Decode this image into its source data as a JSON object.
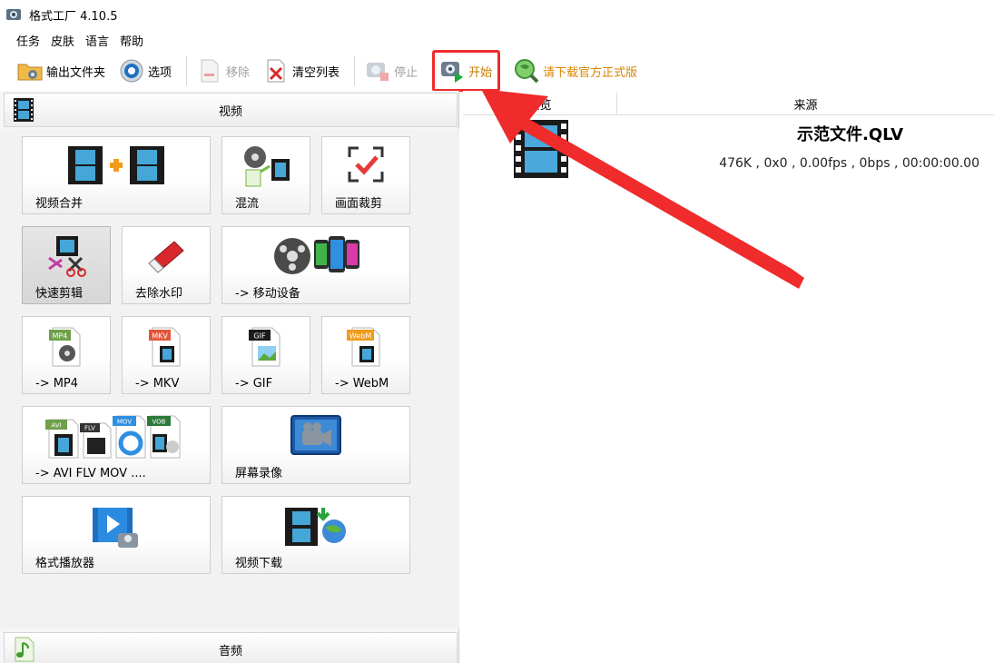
{
  "window": {
    "title": "格式工厂 4.10.5"
  },
  "menu": [
    "任务",
    "皮肤",
    "语言",
    "帮助"
  ],
  "toolbar": {
    "output_folder": "输出文件夹",
    "options": "选项",
    "remove": "移除",
    "clear_list": "清空列表",
    "stop": "停止",
    "start": "开始",
    "download": "请下载官方正式版"
  },
  "left": {
    "video_category": "视频",
    "audio_category": "音频",
    "tiles": {
      "merge": "视频合并",
      "mux": "混流",
      "crop": "画面裁剪",
      "quick_cut": "快速剪辑",
      "remove_watermark": "去除水印",
      "mobile": "-> 移动设备",
      "mp4": "-> MP4",
      "mkv": "-> MKV",
      "gif": "-> GIF",
      "webm": "-> WebM",
      "multi": "-> AVI FLV MOV ....",
      "screen_record": "屏幕录像",
      "player": "格式播放器",
      "download": "视频下载"
    },
    "badges": {
      "mp4": "MP4",
      "mkv": "MKV",
      "gif": "GIF",
      "webm": "WebM",
      "avi": "AVI",
      "flv": "FLV",
      "mov": "MOV",
      "vob": "VOB"
    }
  },
  "right": {
    "columns": {
      "preview": "预览",
      "source": "来源"
    },
    "file": {
      "name": "示范文件.QLV",
      "info": "476K , 0x0 , 0.00fps , 0bps , 00:00:00.00"
    }
  },
  "colors": {
    "highlight": "#ef2b2b",
    "start_text": "#c87a00",
    "download_text": "#d98400"
  }
}
